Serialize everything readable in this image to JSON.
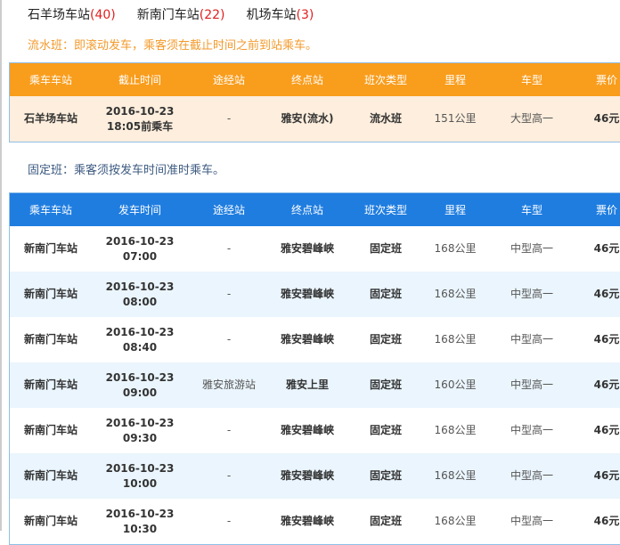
{
  "tabs": [
    {
      "name": "石羊场车站",
      "count": "(40)"
    },
    {
      "name": "新南门车站",
      "count": "(22)"
    },
    {
      "name": "机场车站",
      "count": "(3)"
    }
  ],
  "flow_note": "流水班：即滚动发车，乘客须在截止时间之前到站乘车。",
  "fixed_note": "固定班：乘客须按发车时间准时乘车。",
  "flow_table": {
    "headers": [
      "乘车车站",
      "截止时间",
      "途经站",
      "终点站",
      "班次类型",
      "里程",
      "车型",
      "票价"
    ],
    "rows": [
      {
        "station": "石羊场车站",
        "date": "2016-10-23",
        "time": "18:05",
        "suffix": "前乘车",
        "via": "-",
        "dest": "雅安(流水)",
        "type": "流水班",
        "distance": "151公里",
        "bus": "大型高一",
        "price": "46元"
      }
    ]
  },
  "fixed_table": {
    "headers": [
      "乘车车站",
      "发车时间",
      "途经站",
      "终点站",
      "班次类型",
      "里程",
      "车型",
      "票价"
    ],
    "rows": [
      {
        "station": "新南门车站",
        "date": "2016-10-23",
        "time": "07:00",
        "via": "-",
        "dest": "雅安碧峰峡",
        "type": "固定班",
        "distance": "168公里",
        "bus": "中型高一",
        "price": "46元"
      },
      {
        "station": "新南门车站",
        "date": "2016-10-23",
        "time": "08:00",
        "via": "-",
        "dest": "雅安碧峰峡",
        "type": "固定班",
        "distance": "168公里",
        "bus": "中型高一",
        "price": "46元"
      },
      {
        "station": "新南门车站",
        "date": "2016-10-23",
        "time": "08:40",
        "via": "-",
        "dest": "雅安碧峰峡",
        "type": "固定班",
        "distance": "168公里",
        "bus": "中型高一",
        "price": "46元"
      },
      {
        "station": "新南门车站",
        "date": "2016-10-23",
        "time": "09:00",
        "via": "雅安旅游站",
        "dest": "雅安上里",
        "type": "固定班",
        "distance": "160公里",
        "bus": "中型高一",
        "price": "46元"
      },
      {
        "station": "新南门车站",
        "date": "2016-10-23",
        "time": "09:30",
        "via": "-",
        "dest": "雅安碧峰峡",
        "type": "固定班",
        "distance": "168公里",
        "bus": "中型高一",
        "price": "46元"
      },
      {
        "station": "新南门车站",
        "date": "2016-10-23",
        "time": "10:00",
        "via": "-",
        "dest": "雅安碧峰峡",
        "type": "固定班",
        "distance": "168公里",
        "bus": "中型高一",
        "price": "46元"
      },
      {
        "station": "新南门车站",
        "date": "2016-10-23",
        "time": "10:30",
        "via": "-",
        "dest": "雅安碧峰峡",
        "type": "固定班",
        "distance": "168公里",
        "bus": "中型高一",
        "price": "46元"
      }
    ]
  }
}
